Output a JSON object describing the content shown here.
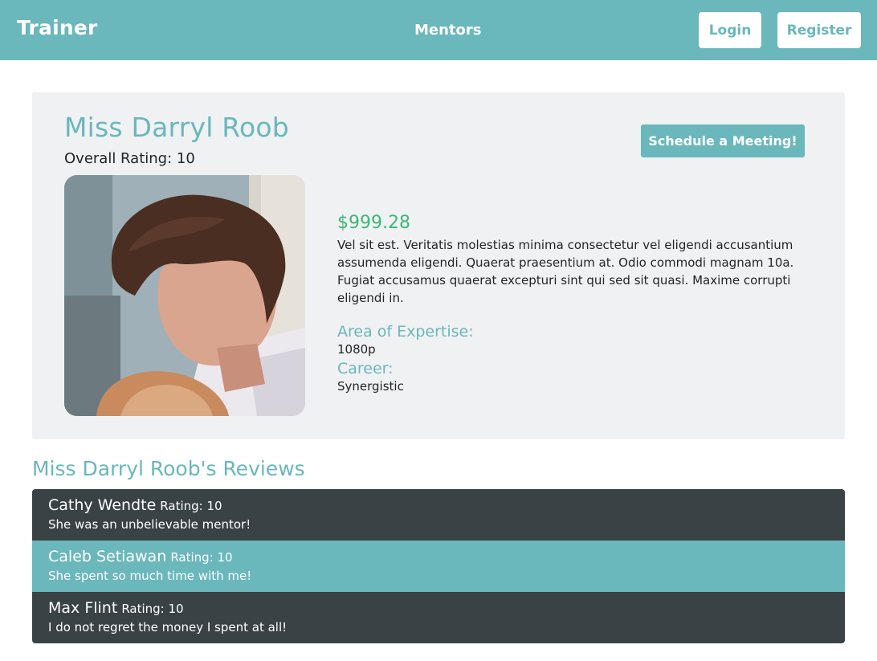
{
  "navbar": {
    "brand": "Trainer",
    "nav_link": "Mentors",
    "login_label": "Login",
    "register_label": "Register"
  },
  "profile": {
    "name": "Miss Darryl Roob",
    "overall_rating": "Overall Rating: 10",
    "schedule_label": "Schedule a Meeting!",
    "price": "$999.28",
    "description": "Vel sit est. Veritatis molestias minima consectetur vel eligendi accusantium assumenda eligendi. Quaerat praesentium at. Odio commodi magnam 10a. Fugiat accusamus quaerat excepturi sint qui sed sit quasi. Maxime corrupti eligendi in.",
    "expertise_label": "Area of Expertise:",
    "expertise_value": "1080p",
    "career_label": "Career:",
    "career_value": "Synergistic"
  },
  "reviews": {
    "heading": "Miss Darryl Roob's Reviews",
    "items": [
      {
        "name": "Cathy Wendte",
        "rating": "Rating: 10",
        "text": "She was an unbelievable mentor!"
      },
      {
        "name": "Caleb Setiawan",
        "rating": "Rating: 10",
        "text": "She spent so much time with me!"
      },
      {
        "name": "Max Flint",
        "rating": "Rating: 10",
        "text": "I do not regret the money I spent at all!"
      }
    ]
  },
  "colors": {
    "accent": "#6ab7bc",
    "dark_row": "#394244",
    "price": "#3cb878",
    "card_bg": "#f0f1f3"
  }
}
